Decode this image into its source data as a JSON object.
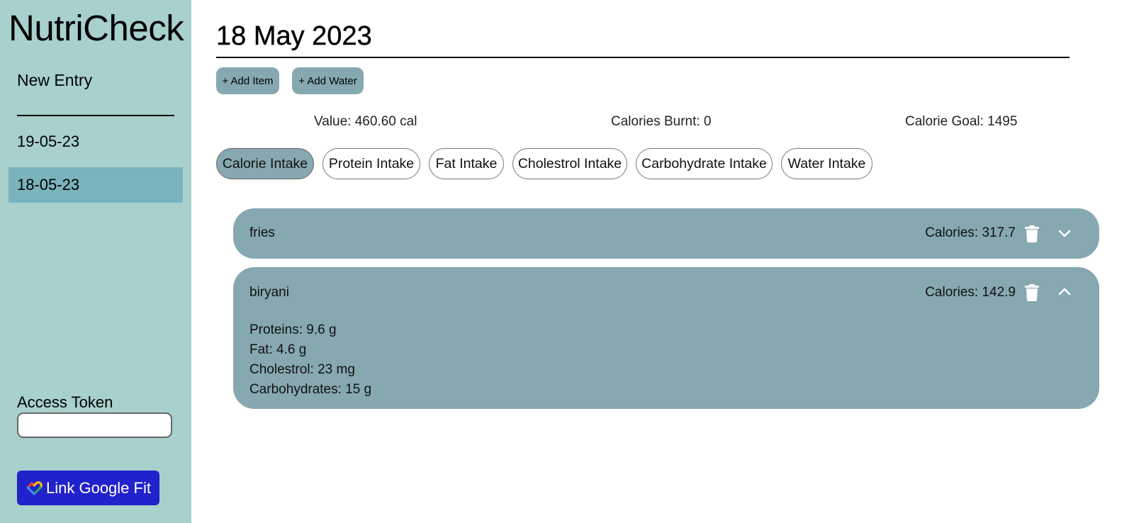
{
  "sidebar": {
    "brand": "NutriCheck",
    "new_entry": "New Entry",
    "dates": [
      "19-05-23",
      "18-05-23"
    ],
    "access_token_label": "Access Token",
    "access_token_value": "",
    "google_fit_label": "Link Google Fit"
  },
  "main": {
    "title": "18 May 2023",
    "add_item": "+ Add Item",
    "add_water": "+ Add Water",
    "stats": {
      "value": "Value: 460.60 cal",
      "burnt": "Calories Burnt: 0",
      "goal": "Calorie Goal: 1495"
    },
    "tabs": [
      "Calorie Intake",
      "Protein Intake",
      "Fat Intake",
      "Cholestrol Intake",
      "Carbohydrate Intake",
      "Water Intake"
    ],
    "active_tab": "Calorie Intake",
    "items": [
      {
        "name": "fries",
        "calories": "Calories: 317.7",
        "expanded": false
      },
      {
        "name": "biryani",
        "calories": "Calories: 142.9",
        "expanded": true,
        "details": [
          "Proteins: 9.6 g",
          "Fat: 4.6 g",
          "Cholestrol: 23 mg",
          "Carbohydrates: 15 g"
        ]
      }
    ]
  },
  "colors": {
    "sidebar_bg": "#a8d0cd",
    "selected_date_bg": "#7ab3bb",
    "card_bg": "#86a8b1",
    "google_fit_bg": "#2222cc"
  },
  "icons": [
    "trash-icon",
    "chevron-down-icon",
    "chevron-up-icon",
    "google-fit-heart-icon"
  ]
}
